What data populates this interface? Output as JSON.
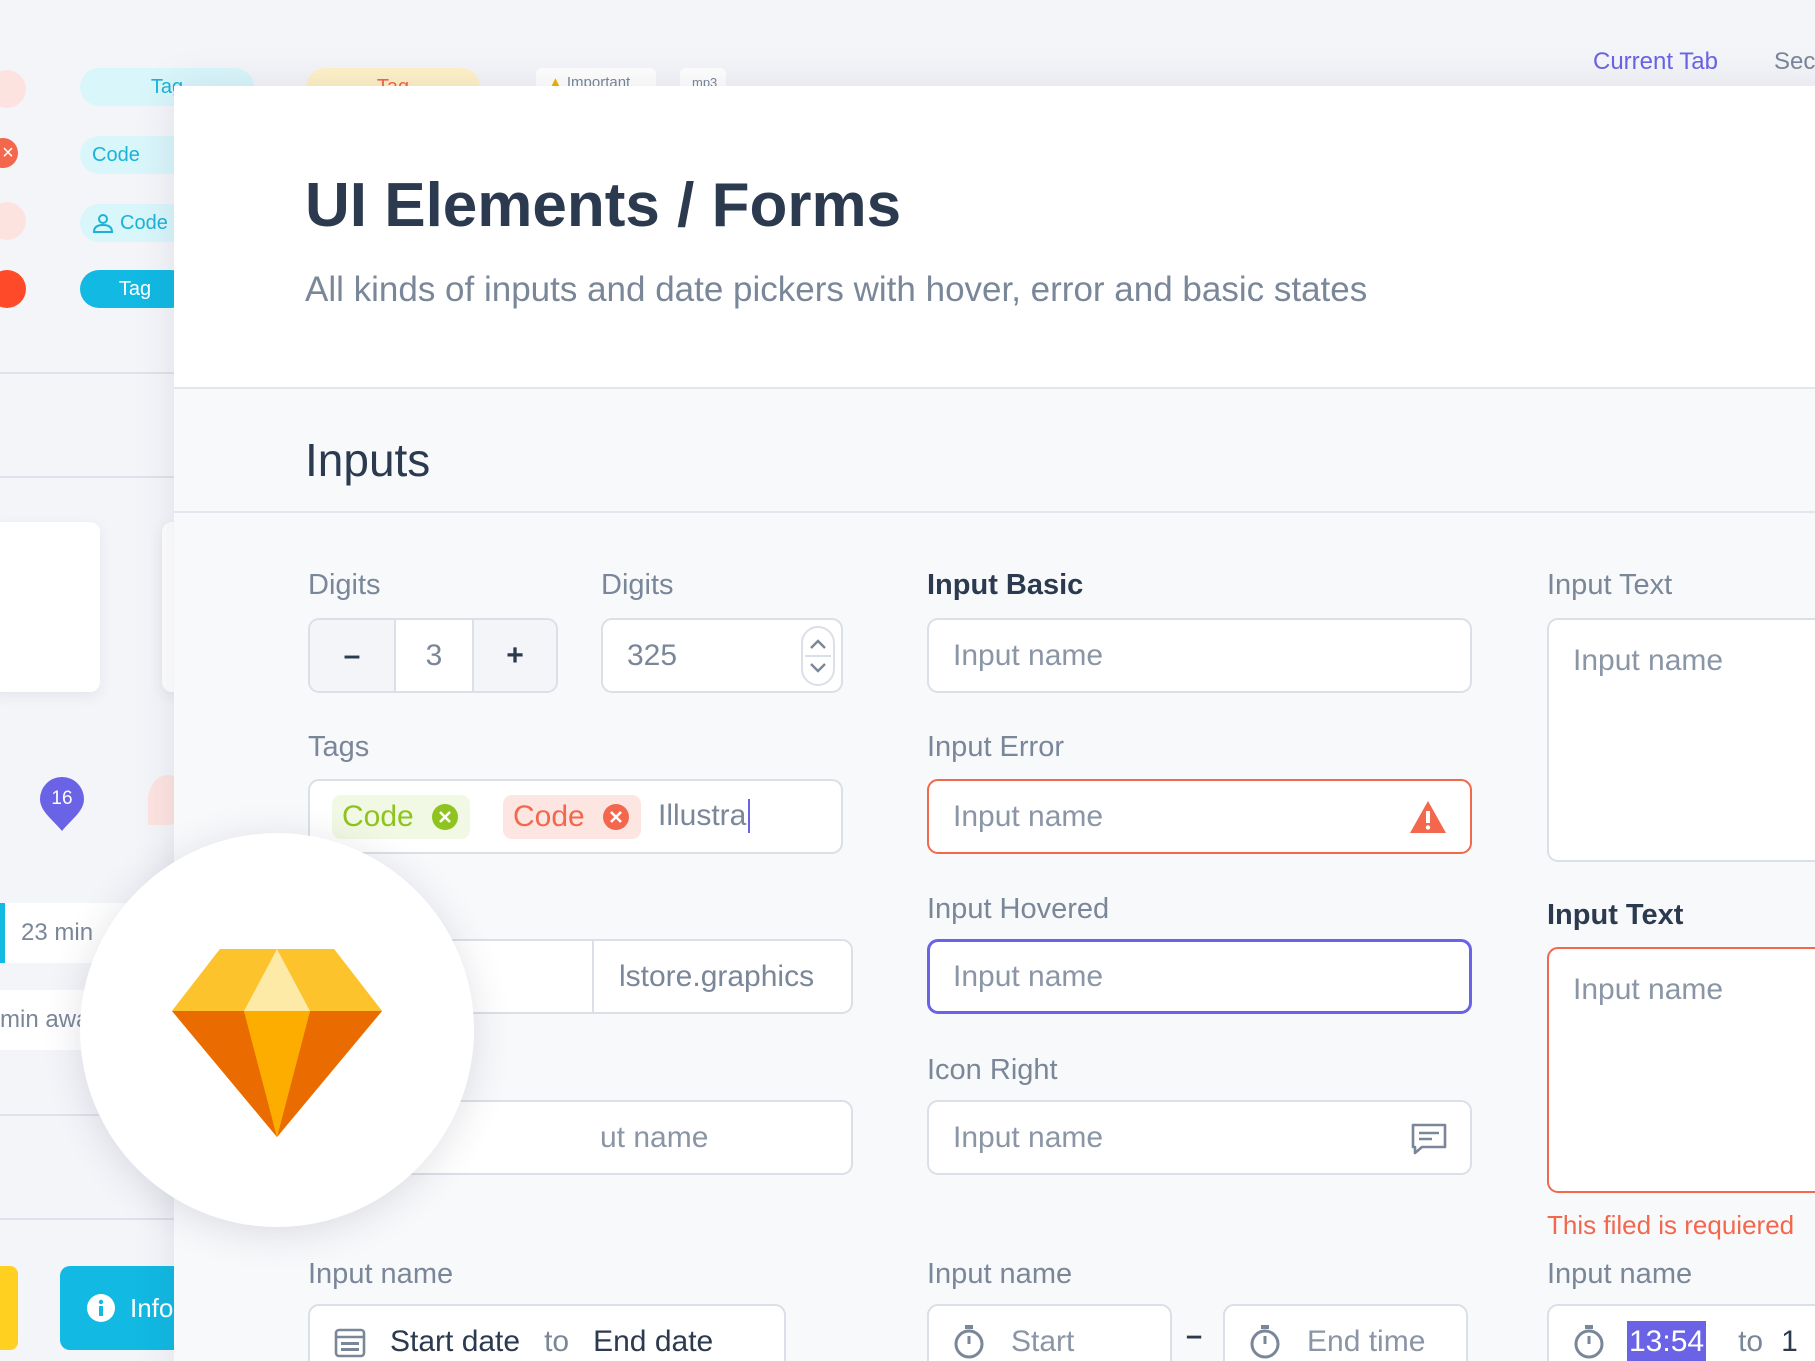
{
  "nav": {
    "current_tab": "Current Tab",
    "second_tab": "Sec"
  },
  "background": {
    "tag1": "Tag",
    "tag2": "Tag",
    "important": "Important",
    "mp3": "mp3",
    "code1": "Code",
    "code2": "Code",
    "tag3": "Tag",
    "badge_count": "16",
    "time1": "23 min",
    "time2": "min away",
    "info": "Info"
  },
  "header": {
    "title": "UI Elements / Forms",
    "subtitle": "All kinds of inputs and date pickers with hover, error and basic states"
  },
  "section": {
    "title": "Inputs"
  },
  "col1": {
    "digits_label_a": "Digits",
    "stepper": {
      "minus": "–",
      "value": "3",
      "plus": "+"
    },
    "digits_label_b": "Digits",
    "spinner_value": "325",
    "tags_label": "Tags",
    "tags": [
      {
        "label": "Code"
      },
      {
        "label": "Code"
      }
    ],
    "tags_input_value": "Illustra",
    "url_value": "lstore.graphics",
    "partial_input_placeholder": "ut name",
    "date_label": "Input name",
    "date": {
      "start": "Start date",
      "to": "to",
      "end": "End date"
    }
  },
  "col2": {
    "basic_label": "Input Basic",
    "basic_placeholder": "Input name",
    "error_label": "Input Error",
    "error_placeholder": "Input name",
    "hover_label": "Input Hovered",
    "hover_placeholder": "Input name",
    "iconright_label": "Icon Right",
    "iconright_placeholder": "Input name",
    "time_label": "Input name",
    "time": {
      "start": "Start",
      "dash": "–",
      "end": "End time"
    }
  },
  "col3": {
    "text_label": "Input Text",
    "text_placeholder": "Input name",
    "text2_label": "Input Text",
    "text2_placeholder": "Input name",
    "error_message": "This filed is requiered",
    "time_label": "Input name",
    "time": {
      "start": "13:54",
      "to": "to",
      "end": "1"
    }
  },
  "colors": {
    "accent": "#6b63e6",
    "error": "#f3674d",
    "success": "#8fc31f",
    "text": "#2c3a4f",
    "muted": "#7a8799"
  }
}
